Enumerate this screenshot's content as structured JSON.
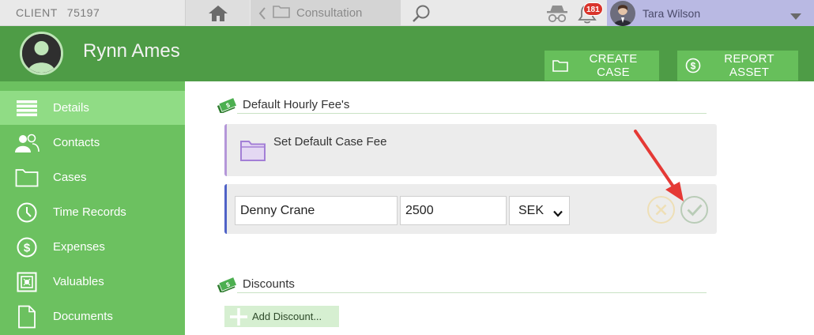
{
  "topbar": {
    "client_label": "CLIENT",
    "client_id": "75197",
    "breadcrumb": "Consultation",
    "notifications_count": "181",
    "user_name": "Tara Wilson"
  },
  "header": {
    "person_name": "Rynn Ames",
    "create_case_label": "CREATE CASE",
    "report_asset_label": "REPORT ASSET"
  },
  "sidebar": {
    "items": [
      {
        "label": "Details",
        "icon": "details-list-icon",
        "active": true
      },
      {
        "label": "Contacts",
        "icon": "contacts-icon",
        "active": false
      },
      {
        "label": "Cases",
        "icon": "folder-icon",
        "active": false
      },
      {
        "label": "Time Records",
        "icon": "clock-icon",
        "active": false
      },
      {
        "label": "Expenses",
        "icon": "dollar-coin-icon",
        "active": false
      },
      {
        "label": "Valuables",
        "icon": "safe-icon",
        "active": false
      },
      {
        "label": "Documents",
        "icon": "document-icon",
        "active": false
      }
    ]
  },
  "main": {
    "fees_section_title": "Default Hourly Fee's",
    "set_default_fee_label": "Set Default Case Fee",
    "fee_row": {
      "name_value": "Denny Crane",
      "amount_value": "2500",
      "currency_value": "SEK"
    },
    "discounts_section_title": "Discounts",
    "add_discount_label": "Add Discount..."
  },
  "colors": {
    "header_green": "#4e9c46",
    "sidebar_green": "#6cc160",
    "active_item": "#90dc85",
    "button_green": "#67bf5b",
    "badge_red": "#d9342b",
    "arrow_red": "#e53935",
    "fee_accent": "#b497d9",
    "edit_accent": "#4f62c7"
  }
}
